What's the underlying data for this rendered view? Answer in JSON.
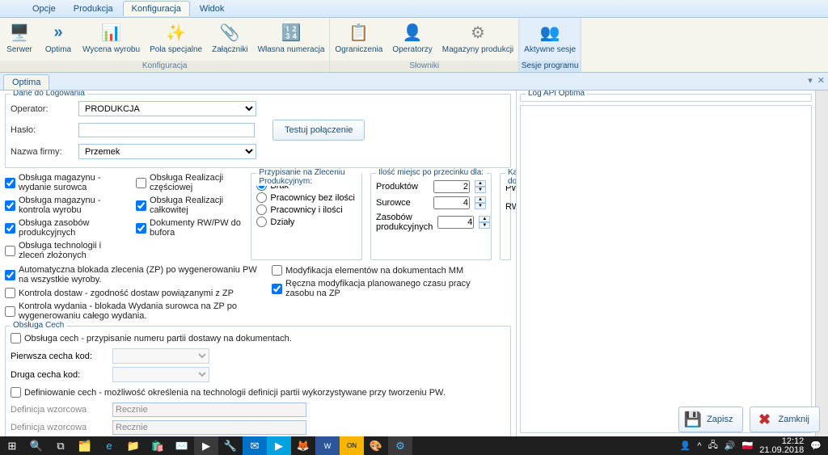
{
  "menubar": {
    "items": [
      "Opcje",
      "Produkcja",
      "Konfiguracja",
      "Widok"
    ],
    "active_index": 2
  },
  "ribbon": {
    "groups": [
      {
        "title": "Konfiguracja",
        "items": [
          {
            "icon": "⚙️",
            "label": "Serwer"
          },
          {
            "icon": "»",
            "label": "Optima",
            "color": "#2a72b8"
          },
          {
            "icon": "📊",
            "label": "Wycena wyrobu",
            "color": "#e6a817"
          },
          {
            "icon": "✨",
            "label": "Pola specjalne",
            "color": "#e6a817"
          },
          {
            "icon": "📎",
            "label": "Załączniki",
            "color": "#e6a817"
          },
          {
            "icon": "🔢",
            "label": "Własna numeracja",
            "color": "#e6a817"
          }
        ]
      },
      {
        "title": "Słowniki",
        "items": [
          {
            "icon": "📋",
            "label": "Ograniczenia"
          },
          {
            "icon": "👤",
            "label": "Operatorzy",
            "color": "#f0a020"
          },
          {
            "icon": "⚙",
            "label": "Magazyny produkcji",
            "color": "#888"
          }
        ]
      },
      {
        "title": "Sesje programu",
        "highlight": true,
        "items": [
          {
            "icon": "👥",
            "label": "Aktywne sesje",
            "color": "#f0a020"
          }
        ]
      }
    ]
  },
  "doc_tab": "Optima",
  "login": {
    "group_title": "Dane do Logowania",
    "operator_label": "Operator:",
    "operator_value": "PRODUKCJA",
    "haslo_label": "Hasło:",
    "haslo_value": "",
    "firma_label": "Nazwa firmy:",
    "firma_value": "Przemek",
    "test_btn": "Testuj połączenie"
  },
  "config": {
    "left_checks": [
      {
        "label": "Obsługa magazynu - wydanie surowca",
        "checked": true
      },
      {
        "label": "Obsługa magazynu - kontrola wyrobu",
        "checked": true
      },
      {
        "label": "Obsługa zasobów produkcyjnych",
        "checked": true
      },
      {
        "label": "Obsługa technologii i zleceń złożonych",
        "checked": false
      }
    ],
    "mid_checks": [
      {
        "label": "Obsługa Realizacji częściowej",
        "checked": false
      },
      {
        "label": "Obsługa Realizacji całkowitej",
        "checked": true
      },
      {
        "label": "Dokumenty RW/PW do bufora",
        "checked": true
      }
    ],
    "assign": {
      "title": "Przypisanie na Zleceniu Produkcyjnym:",
      "options": [
        "Brak",
        "Pracownicy bez ilości",
        "Pracownicy i ilości",
        "Działy"
      ],
      "selected": 0
    },
    "precision": {
      "title": "Ilość miejsc po przecinku dla:",
      "rows": [
        {
          "label": "Produktów",
          "value": "2"
        },
        {
          "label": "Surowce",
          "value": "4"
        },
        {
          "label": "Zasobów produkcyjnych",
          "value": "4"
        }
      ]
    },
    "categories": {
      "title": "Kategorie dla dokumentów:",
      "pw_label": "PW:",
      "rw_label": "RW:"
    },
    "bottom_checks": [
      {
        "label": "Automatyczna blokada zlecenia (ZP) po wygenerowaniu PW na wszystkie wyroby.",
        "checked": true
      },
      {
        "label": "Kontrola dostaw - zgodność dostaw powiązanymi z ZP",
        "checked": false
      },
      {
        "label": "Kontrola wydania - blokada Wydania surowca na ZP po wygenerowaniu całego wydania.",
        "checked": false
      }
    ],
    "bottom_right_checks": [
      {
        "label": "Modyfikacja elementów na dokumentach MM",
        "checked": false
      },
      {
        "label": "Ręczna modyfikacja planowanego czasu pracy zasobu  na ZP",
        "checked": true
      }
    ]
  },
  "cechy": {
    "group_title": "Obsługa Cech",
    "enable_label": "Obsługa cech - przypisanie numeru partii dostawy na dokumentach.",
    "pierwsza_label": "Pierwsza cecha kod:",
    "druga_label": "Druga cecha kod:",
    "def_label": "Definiowanie cech - możliwość określenia na technologii definicji partii wykorzystywane przy tworzeniu PW.",
    "wzorcowa_label": "Definicja wzorcowa",
    "wzorcowa_value": "Recznie"
  },
  "log": {
    "title": "Log API Optima"
  },
  "actions": {
    "save": "Zapisz",
    "close": "Zamknij"
  },
  "taskbar": {
    "clock_time": "12:12",
    "clock_date": "21.09.2018"
  }
}
